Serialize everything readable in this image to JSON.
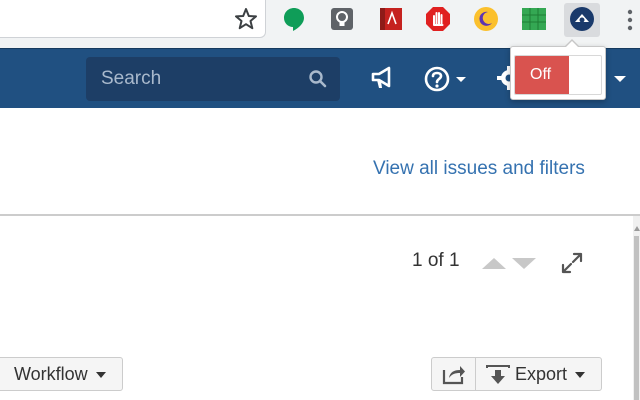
{
  "header": {
    "search_placeholder": "Search"
  },
  "toggle": {
    "state_label": "Off"
  },
  "main": {
    "view_all_link": "View all issues and filters",
    "pager": "1 of 1"
  },
  "toolbar": {
    "workflow_label": "Workflow",
    "export_label": "Export"
  },
  "colors": {
    "header_bg": "#205081",
    "link": "#3572b0",
    "toggle_off": "#d9534f"
  },
  "icons": [
    "star-icon",
    "hangouts-extension-icon",
    "keep-extension-icon",
    "pdf-extension-icon",
    "adblock-extension-icon",
    "moon-extension-icon",
    "sheets-extension-icon",
    "active-extension-icon",
    "browser-menu-icon",
    "search-icon",
    "megaphone-icon",
    "help-icon",
    "gear-icon",
    "chevron-down-icon",
    "pager-up-icon",
    "pager-down-icon",
    "expand-icon",
    "share-icon",
    "export-icon"
  ]
}
